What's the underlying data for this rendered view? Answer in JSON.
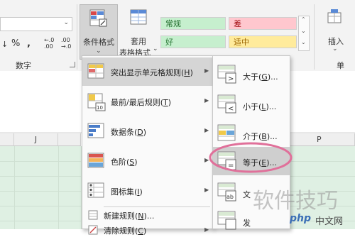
{
  "ribbon": {
    "font_combo_value": "",
    "number_format_value": "",
    "percent_symbol": "%",
    "comma_symbol": ",",
    "inc_decimal_label": "←.0\n.00",
    "dec_decimal_label": ".00\n→.0",
    "number_group_label": "数字",
    "cond_format_label": "条件格式",
    "table_format_label_1": "套用",
    "table_format_label_2": "表格格式",
    "styles": {
      "normal": "常规",
      "bad": "差",
      "good": "好",
      "neutral": "适中"
    },
    "insert_label": "插入",
    "insert_group_label": "单"
  },
  "sheet": {
    "col_j": "J",
    "col_p": "P"
  },
  "cf_menu": {
    "items": [
      {
        "label": "突出显示单元格规则(",
        "key": "H",
        "suffix": ")"
      },
      {
        "label": "最前/最后规则(",
        "key": "T",
        "suffix": ")"
      },
      {
        "label": "数据条(",
        "key": "D",
        "suffix": ")"
      },
      {
        "label": "色阶(",
        "key": "S",
        "suffix": ")"
      },
      {
        "label": "图标集(",
        "key": "I",
        "suffix": ")"
      },
      {
        "label": "新建规则(",
        "key": "N",
        "suffix": ")..."
      },
      {
        "label": "清除规则(",
        "key": "C",
        "suffix": ")"
      }
    ]
  },
  "submenu": {
    "items": [
      {
        "label": "大于(",
        "key": "G",
        "suffix": ")..."
      },
      {
        "label": "小于(",
        "key": "L",
        "suffix": ")..."
      },
      {
        "label": "介于(",
        "key": "B",
        "suffix": ")..."
      },
      {
        "label": "等于(",
        "key": "E",
        "suffix": ")..."
      },
      {
        "label": "文",
        "key": "",
        "suffix": ""
      },
      {
        "label": "发",
        "key": "",
        "suffix": ""
      }
    ]
  },
  "watermark": {
    "text": "软件技巧",
    "logo_text": "php",
    "site": "中文网"
  },
  "colors": {
    "good_bg": "#c6efce",
    "bad_bg": "#ffc7ce",
    "neutral_bg": "#ffeb9c",
    "highlight_circle": "#e0709a"
  }
}
